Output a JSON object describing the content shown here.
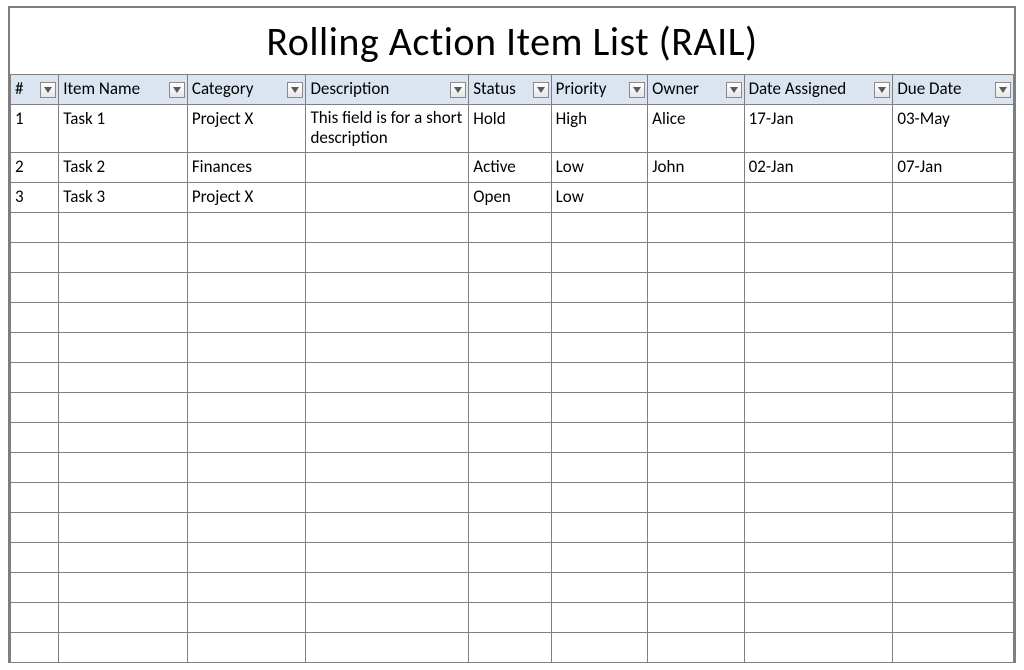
{
  "title": "Rolling Action Item List (RAIL)",
  "columns": [
    {
      "key": "num",
      "label": "#"
    },
    {
      "key": "name",
      "label": "Item Name"
    },
    {
      "key": "category",
      "label": "Category"
    },
    {
      "key": "desc",
      "label": "Description"
    },
    {
      "key": "status",
      "label": "Status"
    },
    {
      "key": "priority",
      "label": "Priority"
    },
    {
      "key": "owner",
      "label": "Owner"
    },
    {
      "key": "assigned",
      "label": "Date Assigned"
    },
    {
      "key": "due",
      "label": "Due Date"
    }
  ],
  "rows": [
    {
      "num": "1",
      "name": "Task 1",
      "category": "Project X",
      "desc": "This field is for a short description",
      "status": "Hold",
      "priority": "High",
      "owner": "Alice",
      "assigned": "17-Jan",
      "due": "03-May"
    },
    {
      "num": "2",
      "name": "Task 2",
      "category": "Finances",
      "desc": "",
      "status": "Active",
      "priority": "Low",
      "owner": "John",
      "assigned": "02-Jan",
      "due": "07-Jan"
    },
    {
      "num": "3",
      "name": "Task 3",
      "category": "Project X",
      "desc": "",
      "status": "Open",
      "priority": "Low",
      "owner": "",
      "assigned": "",
      "due": ""
    }
  ],
  "emptyRowCount": 15
}
